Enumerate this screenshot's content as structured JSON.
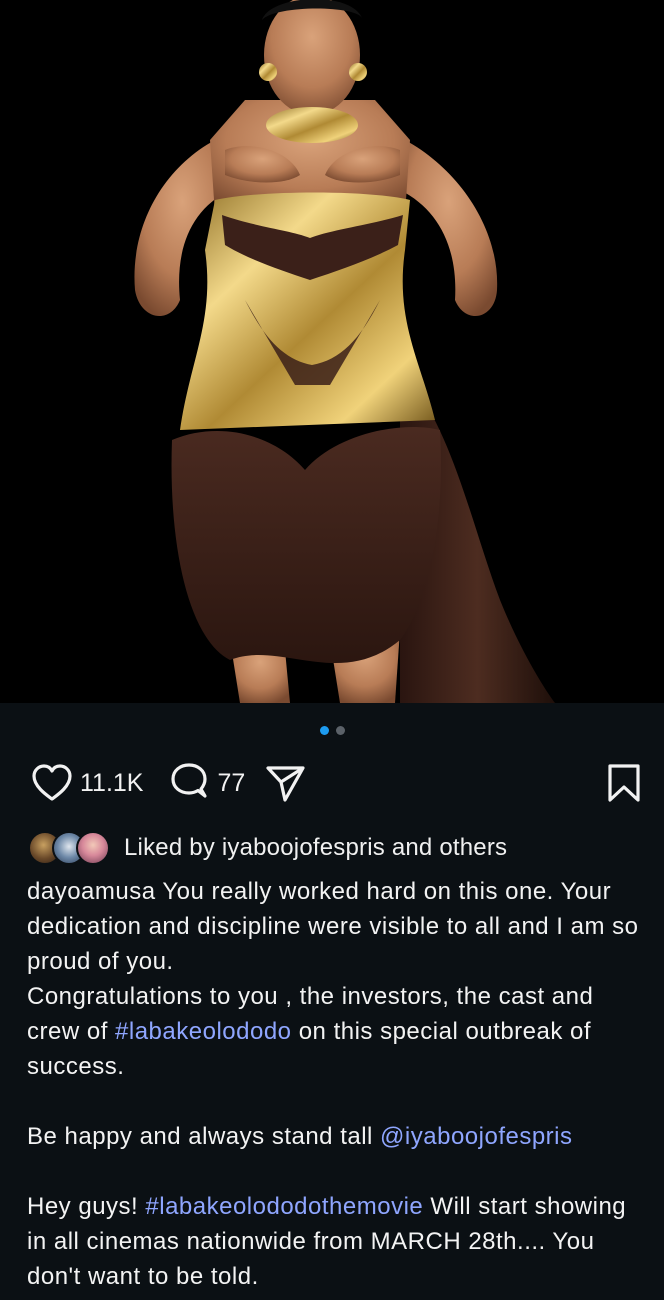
{
  "post": {
    "image_alt": "Woman in a gold metallic corset and brown draped mini dress",
    "carousel": {
      "count": 2,
      "active": 0
    },
    "actions": {
      "like_count": "11.1K",
      "comment_count": "77"
    },
    "liked_by": {
      "prefix": "Liked by ",
      "user": "iyaboojofespris",
      "suffix": " and others"
    },
    "caption": {
      "username": "dayoamusa",
      "line1": " You really worked hard on this one. Your dedication and discipline were visible to all and I am so proud of you.",
      "line2_a": "Congratulations to you , the investors, the cast and crew of ",
      "hashtag1": "#labakeolododo",
      "line2_b": " on this special outbreak of success.",
      "line3_a": "Be happy and always stand tall ",
      "mention": "@iyaboojofespris",
      "line4_a": "Hey guys! ",
      "hashtag2": "#labakeolododothemovie",
      "line4_b": " Will start showing in all cinemas nationwide from MARCH 28th.... You don't want to be told."
    }
  },
  "colors": {
    "background": "#0b1014",
    "link": "#8fa6ff",
    "active_dot": "#1d9bf0"
  },
  "icons": [
    "heart-icon",
    "comment-icon",
    "share-icon",
    "bookmark-icon"
  ]
}
